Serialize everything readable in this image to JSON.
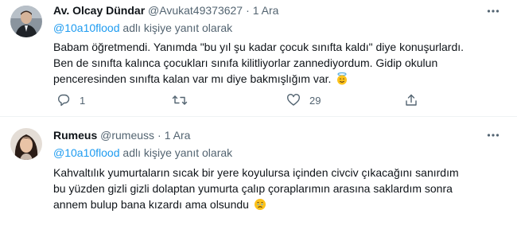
{
  "tweets": [
    {
      "author_name": "Av. Olcay Dündar",
      "handle": "@Avukat49373627",
      "separator": "·",
      "time": "1 Ara",
      "replying_to": {
        "mention": "@10a10flood",
        "suffix": " adlı kişiye yanıt olarak"
      },
      "text_lines": [
        "Babam öğretmendi. Yanımda \"bu yıl şu kadar çocuk sınıfta kaldı\" diye konuşurlardı.",
        "Ben de sınıfta kalınca çocukları sınıfa kilitliyorlar zannediyordum. Gidip okulun",
        "penceresinden sınıfta kalan var mı diye bakmışlığım var."
      ],
      "emoji": "smiling-face-with-halo",
      "reply_count": "1",
      "retweet_count": "",
      "like_count": "29"
    },
    {
      "author_name": "Rumeus",
      "handle": "@rumeuss",
      "separator": "·",
      "time": "1 Ara",
      "replying_to": {
        "mention": "@10a10flood",
        "suffix": " adlı kişiye yanıt olarak"
      },
      "text_lines": [
        "Kahvaltılık yumurtaların sıcak bir yere koyulursa içinden civciv çıkacağını sanırdım",
        "bu yüzden gizli gizli dolaptan yumurta çalıp çoraplarımın arasına saklardım sonra",
        "annem bulup bana kızardı ama olsundu"
      ],
      "emoji": "face-holding-back-tears"
    }
  ],
  "colors": {
    "text": "#0f1419",
    "secondary": "#536471",
    "link": "#1d9bf0",
    "divider": "#eff3f4"
  }
}
